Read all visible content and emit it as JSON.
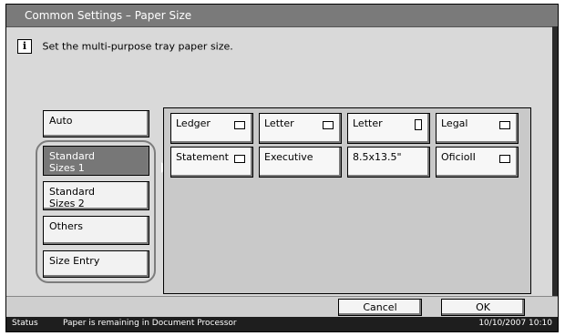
{
  "window": {
    "title": "Common Settings – Paper Size"
  },
  "info": {
    "icon": "info-icon",
    "message": "Set the multi-purpose tray paper size."
  },
  "sidebar": {
    "items": [
      {
        "label_line1": "Auto",
        "label_line2": ""
      },
      {
        "label_line1": "Standard",
        "label_line2": "Sizes 1"
      },
      {
        "label_line1": "Standard",
        "label_line2": "Sizes 2"
      },
      {
        "label_line1": "Others",
        "label_line2": ""
      },
      {
        "label_line1": "Size Entry",
        "label_line2": ""
      }
    ],
    "selected": "Standard Sizes 1"
  },
  "paper_sizes": [
    {
      "label": "Ledger",
      "orientation": "landscape"
    },
    {
      "label": "Letter",
      "orientation": "landscape"
    },
    {
      "label": "Letter",
      "orientation": "portrait"
    },
    {
      "label": "Legal",
      "orientation": "landscape"
    },
    {
      "label": "Statement",
      "orientation": "landscape"
    },
    {
      "label": "Executive",
      "orientation": ""
    },
    {
      "label": "8.5x13.5\"",
      "orientation": ""
    },
    {
      "label": "OficioII",
      "orientation": "landscape"
    }
  ],
  "actions": {
    "cancel": "Cancel",
    "ok": "OK"
  },
  "status": {
    "label": "Status",
    "message": "Paper is remaining in Document Processor",
    "datetime": "10/10/2007   10:10"
  }
}
